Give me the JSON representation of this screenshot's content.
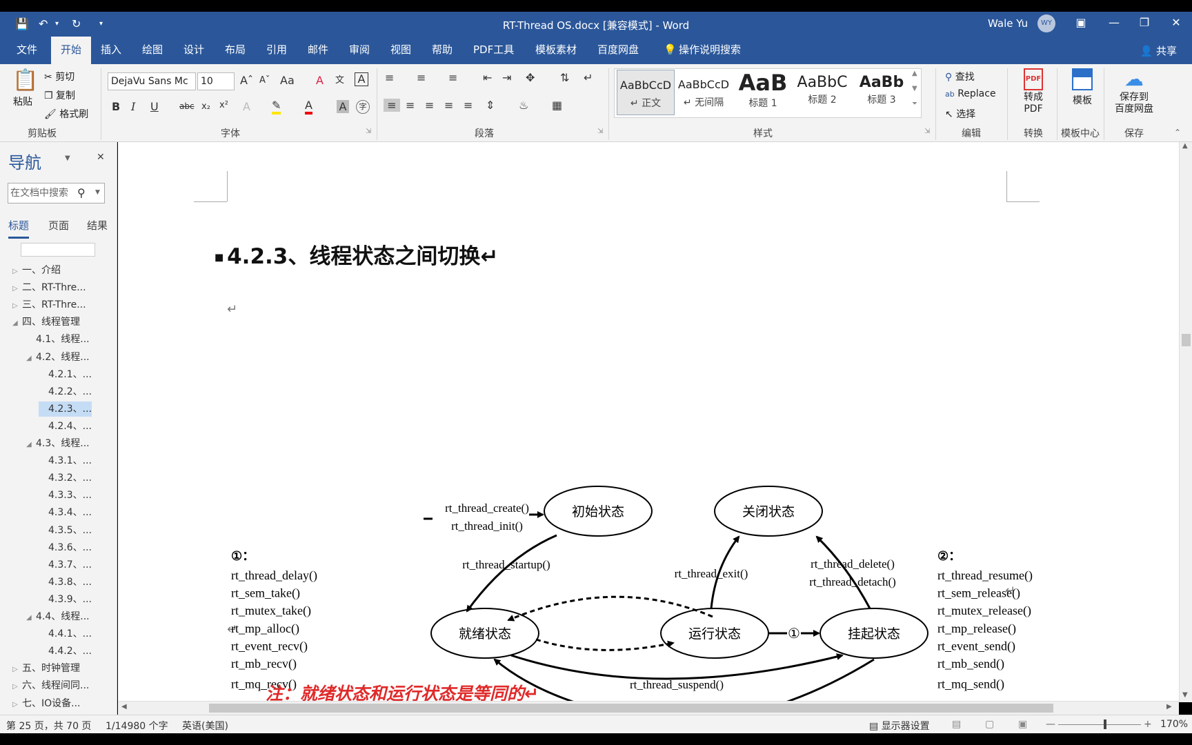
{
  "titlebar": {
    "doc_title": "RT-Thread OS.docx [兼容模式] - Word",
    "user_name": "Wale Yu",
    "user_initials": "WY"
  },
  "tabs": [
    "文件",
    "开始",
    "插入",
    "绘图",
    "设计",
    "布局",
    "引用",
    "邮件",
    "审阅",
    "视图",
    "帮助",
    "PDF工具",
    "模板素材",
    "百度网盘"
  ],
  "active_tab": "开始",
  "tell_me": "操作说明搜索",
  "share": "共享",
  "ribbon": {
    "clipboard": {
      "paste": "粘贴",
      "cut": "剪切",
      "copy": "复制",
      "format_painter": "格式刷",
      "label": "剪贴板"
    },
    "font": {
      "name": "DejaVu Sans Mc",
      "size": "10",
      "label": "字体"
    },
    "paragraph": {
      "label": "段落"
    },
    "styles": {
      "items": [
        {
          "sample": "AaBbCcD",
          "name": "↵ 正文"
        },
        {
          "sample": "AaBbCcD",
          "name": "↵ 无间隔"
        },
        {
          "sample": "AaB",
          "name": "标题 1"
        },
        {
          "sample": "AaBbC",
          "name": "标题 2"
        },
        {
          "sample": "AaBb",
          "name": "标题 3"
        }
      ],
      "label": "样式"
    },
    "editing": {
      "find": "查找",
      "replace": "Replace",
      "select": "选择",
      "label": "编辑"
    },
    "convert": {
      "button": "转成\nPDF",
      "label": "转换"
    },
    "template": {
      "button": "模板",
      "label": "模板中心"
    },
    "save": {
      "button": "保存到\n百度网盘",
      "label": "保存"
    }
  },
  "nav": {
    "title": "导航",
    "search_placeholder": "在文档中搜索",
    "tabs": [
      "标题",
      "页面",
      "结果"
    ],
    "items": [
      {
        "text": "一、介绍",
        "level": 0,
        "state": "collapsed"
      },
      {
        "text": "二、RT-Thre...",
        "level": 0,
        "state": "collapsed"
      },
      {
        "text": "三、RT-Thre...",
        "level": 0,
        "state": "collapsed"
      },
      {
        "text": "四、线程管理",
        "level": 0,
        "state": "expanded"
      },
      {
        "text": "4.1、线程...",
        "level": 1,
        "state": "leaf"
      },
      {
        "text": "4.2、线程...",
        "level": 1,
        "state": "expanded"
      },
      {
        "text": "4.2.1、...",
        "level": 2,
        "state": "leaf"
      },
      {
        "text": "4.2.2、...",
        "level": 2,
        "state": "leaf"
      },
      {
        "text": "4.2.3、...",
        "level": 2,
        "state": "leaf",
        "selected": true
      },
      {
        "text": "4.2.4、...",
        "level": 2,
        "state": "leaf"
      },
      {
        "text": "4.3、线程...",
        "level": 1,
        "state": "expanded"
      },
      {
        "text": "4.3.1、...",
        "level": 2,
        "state": "leaf"
      },
      {
        "text": "4.3.2、...",
        "level": 2,
        "state": "leaf"
      },
      {
        "text": "4.3.3、...",
        "level": 2,
        "state": "leaf"
      },
      {
        "text": "4.3.4、...",
        "level": 2,
        "state": "leaf"
      },
      {
        "text": "4.3.5、...",
        "level": 2,
        "state": "leaf"
      },
      {
        "text": "4.3.6、...",
        "level": 2,
        "state": "leaf"
      },
      {
        "text": "4.3.7、...",
        "level": 2,
        "state": "leaf"
      },
      {
        "text": "4.3.8、...",
        "level": 2,
        "state": "leaf"
      },
      {
        "text": "4.3.9、...",
        "level": 2,
        "state": "leaf"
      },
      {
        "text": "4.4、线程...",
        "level": 1,
        "state": "expanded"
      },
      {
        "text": "4.4.1、...",
        "level": 2,
        "state": "leaf"
      },
      {
        "text": "4.4.2、...",
        "level": 2,
        "state": "leaf"
      },
      {
        "text": "五、时钟管理",
        "level": 0,
        "state": "collapsed"
      },
      {
        "text": "六、线程间同...",
        "level": 0,
        "state": "collapsed"
      },
      {
        "text": "七、IO设备...",
        "level": 0,
        "state": "collapsed"
      }
    ]
  },
  "document": {
    "heading": "4.2.3、线程状态之间切换↵",
    "paragraph_mark": "↵",
    "note": "注：就绪状态和运行状态是等同的↵"
  },
  "diagram": {
    "states": {
      "init": "初始状态",
      "closed": "关闭状态",
      "ready": "就绪状态",
      "running": "运行状态",
      "suspended": "挂起状态"
    },
    "edges": {
      "create": [
        "rt_thread_create()",
        "rt_thread_init()"
      ],
      "startup": "rt_thread_startup()",
      "exit": "rt_thread_exit()",
      "delete": [
        "rt_thread_delete()",
        "rt_thread_detach()"
      ],
      "suspend": "rt_thread_suspend()",
      "marker1": "①",
      "marker2": "②"
    },
    "list1": {
      "title": "①：",
      "items": [
        "rt_thread_delay()",
        "rt_sem_take()",
        "rt_mutex_take()",
        "rt_mp_alloc()",
        "rt_event_recv()",
        "rt_mb_recv()",
        "rt_mq_recv()"
      ]
    },
    "list2": {
      "title": "②：",
      "items": [
        "rt_thread_resume()",
        "rt_sem_release()",
        "rt_mutex_release()",
        "rt_mp_release()",
        "rt_event_send()",
        "rt_mb_send()",
        "rt_mq_send()"
      ]
    }
  },
  "statusbar": {
    "page": "第 25 页，共 70 页",
    "words": "1/14980 个字",
    "language": "英语(美国)",
    "display": "显示器设置",
    "zoom": "170%"
  }
}
